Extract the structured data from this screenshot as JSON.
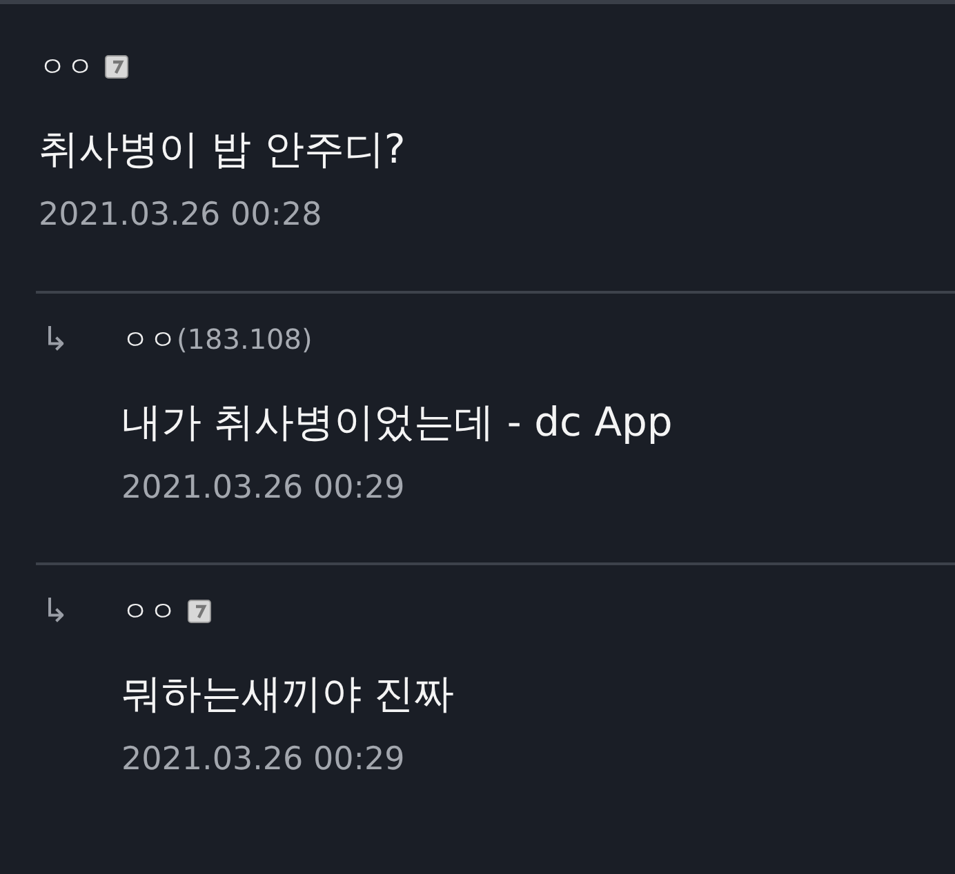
{
  "comments": [
    {
      "kind": "comment",
      "name": "ㅇㅇ",
      "badge": true,
      "text": "취사병이 밥 안주디?",
      "date": "2021.03.26 00:28"
    },
    {
      "kind": "reply",
      "arrow": "↳",
      "name": "ㅇㅇ",
      "ip": "(183.108)",
      "badge": false,
      "text": "내가 취사병이었는데 - dc App",
      "date": "2021.03.26 00:29"
    },
    {
      "kind": "reply",
      "arrow": "↳",
      "name": "ㅇㅇ",
      "badge": true,
      "text": "뭐하는새끼야 진짜",
      "date": "2021.03.26 00:29"
    }
  ]
}
